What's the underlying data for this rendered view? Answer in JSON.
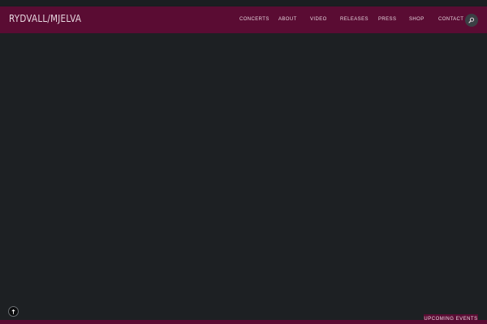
{
  "site": {
    "brand": "RYDVALL/MJELVA"
  },
  "nav": {
    "items": [
      {
        "label": "CONCERTS"
      },
      {
        "label": "ABOUT"
      },
      {
        "label": "VIDEO"
      },
      {
        "label": "RELEASES"
      },
      {
        "label": "PRESS"
      },
      {
        "label": "SHOP"
      },
      {
        "label": "CONTACT"
      }
    ],
    "search_icon": "search-icon"
  },
  "footer": {
    "events_label": "UPCOMING EVENTS",
    "scroll_icon": "arrow-up-icon"
  },
  "colors": {
    "background": "#1d2023",
    "accent": "#5a0c33",
    "text_light": "#e7d4de"
  }
}
